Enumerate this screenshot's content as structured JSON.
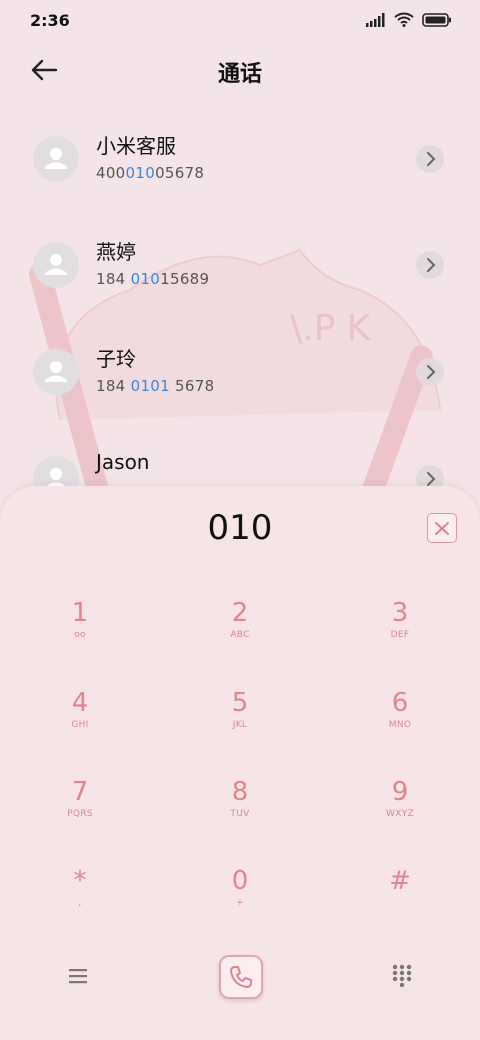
{
  "status": {
    "time": "2:36",
    "icons": [
      "signal-icon",
      "wifi-icon",
      "battery-icon"
    ]
  },
  "header": {
    "title": "通话",
    "back_icon": "back-arrow-icon"
  },
  "contacts": [
    {
      "name": "小米客服",
      "num_pre": "400",
      "num_hl": "010",
      "num_post": "05678"
    },
    {
      "name": "燕婷",
      "num_pre": "184 ",
      "num_hl": "010",
      "num_post": "15689"
    },
    {
      "name": "子玲",
      "num_pre": "184 ",
      "num_hl": "0101",
      "num_post": " 5678"
    },
    {
      "name": "Jason",
      "num_pre": "",
      "num_hl": "",
      "num_post": ""
    }
  ],
  "dialer": {
    "input": "010",
    "keys": [
      {
        "digit": "1",
        "letters": "ᴏᴏ"
      },
      {
        "digit": "2",
        "letters": "ABC"
      },
      {
        "digit": "3",
        "letters": "DEF"
      },
      {
        "digit": "4",
        "letters": "GHI"
      },
      {
        "digit": "5",
        "letters": "JKL"
      },
      {
        "digit": "6",
        "letters": "MNO"
      },
      {
        "digit": "7",
        "letters": "PQRS"
      },
      {
        "digit": "8",
        "letters": "TUV"
      },
      {
        "digit": "9",
        "letters": "WXYZ"
      },
      {
        "digit": "*",
        "letters": ","
      },
      {
        "digit": "0",
        "letters": "+"
      },
      {
        "digit": "#",
        "letters": ""
      }
    ]
  },
  "colors": {
    "accent": "#e08590",
    "highlight": "#3a86d6",
    "background": "#f4e4e7"
  }
}
